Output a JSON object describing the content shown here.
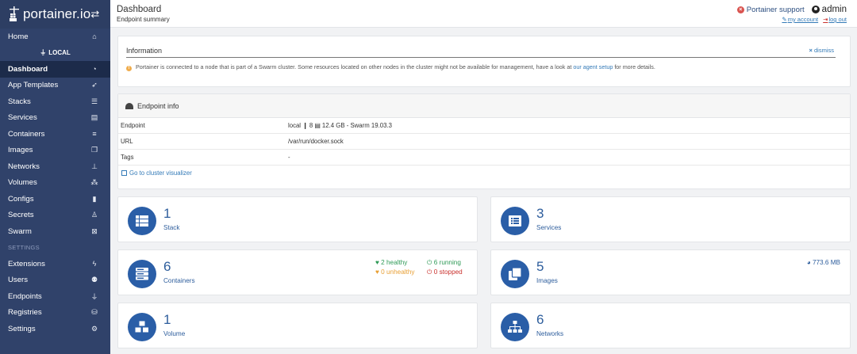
{
  "brand": {
    "name": "portainer.io"
  },
  "sidebar": {
    "home": "Home",
    "endpoint": "LOCAL",
    "items": [
      {
        "label": "Dashboard",
        "icon": "dashboard-icon"
      },
      {
        "label": "App Templates",
        "icon": "rocket-icon"
      },
      {
        "label": "Stacks",
        "icon": "list-icon"
      },
      {
        "label": "Services",
        "icon": "services-icon"
      },
      {
        "label": "Containers",
        "icon": "server-icon"
      },
      {
        "label": "Images",
        "icon": "clone-icon"
      },
      {
        "label": "Networks",
        "icon": "sitemap-icon"
      },
      {
        "label": "Volumes",
        "icon": "cubes-icon"
      },
      {
        "label": "Configs",
        "icon": "file-icon"
      },
      {
        "label": "Secrets",
        "icon": "user-secret-icon"
      },
      {
        "label": "Swarm",
        "icon": "object-group-icon"
      }
    ],
    "settings_section": "SETTINGS",
    "settings_items": [
      {
        "label": "Extensions",
        "icon": "bolt-icon"
      },
      {
        "label": "Users",
        "icon": "users-icon"
      },
      {
        "label": "Endpoints",
        "icon": "plug-icon"
      },
      {
        "label": "Registries",
        "icon": "database-icon"
      },
      {
        "label": "Settings",
        "icon": "cogs-icon"
      }
    ]
  },
  "header": {
    "title": "Dashboard",
    "subtitle": "Endpoint summary",
    "support": "Portainer support",
    "user": "admin",
    "my_account": "my account",
    "log_out": "log out"
  },
  "info": {
    "title": "Information",
    "dismiss": "dismiss",
    "text_before": "Portainer is connected to a node that is part of a Swarm cluster. Some resources located on other nodes in the cluster might not be available for management, have a look at",
    "link": "our agent setup",
    "text_after": "for more details."
  },
  "endpoint_info": {
    "title": "Endpoint info",
    "rows": [
      {
        "key": "Endpoint",
        "value": "local  ❙ 8  ▤ 12.4 GB - Swarm 19.03.3"
      },
      {
        "key": "URL",
        "value": "/var/run/docker.sock"
      },
      {
        "key": "Tags",
        "value": "-"
      }
    ],
    "visualizer_link": "Go to cluster visualizer"
  },
  "widgets": {
    "stacks": {
      "count": "1",
      "label": "Stack"
    },
    "services": {
      "count": "3",
      "label": "Services"
    },
    "containers": {
      "count": "6",
      "label": "Containers",
      "healthy": "2 healthy",
      "running": "6 running",
      "unhealthy": "0 unhealthy",
      "stopped": "0 stopped"
    },
    "images": {
      "count": "5",
      "label": "Images",
      "size": "773.6 MB"
    },
    "volumes": {
      "count": "1",
      "label": "Volume"
    },
    "networks": {
      "count": "6",
      "label": "Networks"
    }
  },
  "colors": {
    "sidebar_bg": "#30426a",
    "accent": "#2a5ea7",
    "link": "#337ab7",
    "healthy": "#2f9a57",
    "unhealthy": "#e89f34",
    "stopped": "#c9302c"
  }
}
